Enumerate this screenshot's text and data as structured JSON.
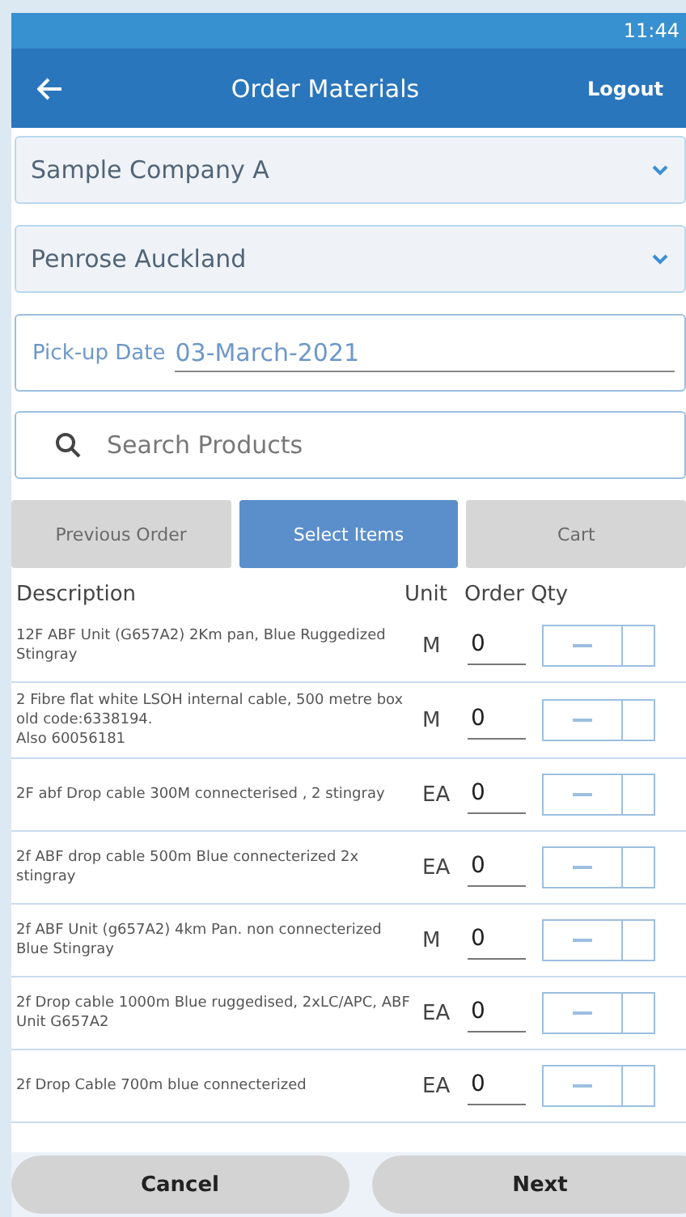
{
  "status_bar": {
    "time": "11:44"
  },
  "header": {
    "title": "Order Materials",
    "action": "Logout"
  },
  "company_select": {
    "value": "Sample Company A"
  },
  "location_select": {
    "value": "Penrose Auckland"
  },
  "pickup_date": {
    "label": "Pick-up Date",
    "value": "03-March-2021"
  },
  "search": {
    "placeholder": "Search Products"
  },
  "tabs": [
    {
      "label": "Previous Order",
      "selected": false
    },
    {
      "label": "Select Items",
      "selected": true
    },
    {
      "label": "Cart",
      "selected": false
    }
  ],
  "table": {
    "columns": [
      "Description",
      "Unit",
      "Order Qty"
    ],
    "rows": [
      {
        "description": "12F ABF Unit (G657A2) 2Km pan, Blue Ruggedized Stingray",
        "unit": "M",
        "qty": "0"
      },
      {
        "description": "2 Fibre flat white LSOH internal cable, 500 metre box old code:6338194.\nAlso 60056181",
        "unit": "M",
        "qty": "0"
      },
      {
        "description": "2F abf Drop cable 300M connecterised , 2 stingray",
        "unit": "EA",
        "qty": "0"
      },
      {
        "description": "2f ABF drop cable 500m Blue connecterized 2x stingray",
        "unit": "EA",
        "qty": "0"
      },
      {
        "description": "2f ABF Unit (g657A2) 4km Pan. non connecterized Blue Stingray",
        "unit": "M",
        "qty": "0"
      },
      {
        "description": "2f Drop cable 1000m Blue ruggedised, 2xLC/APC, ABF Unit G657A2",
        "unit": "EA",
        "qty": "0"
      },
      {
        "description": "2f Drop Cable 700m blue connecterized",
        "unit": "EA",
        "qty": "0"
      }
    ]
  },
  "footer": {
    "buttons": [
      "Cancel",
      "Next"
    ]
  }
}
